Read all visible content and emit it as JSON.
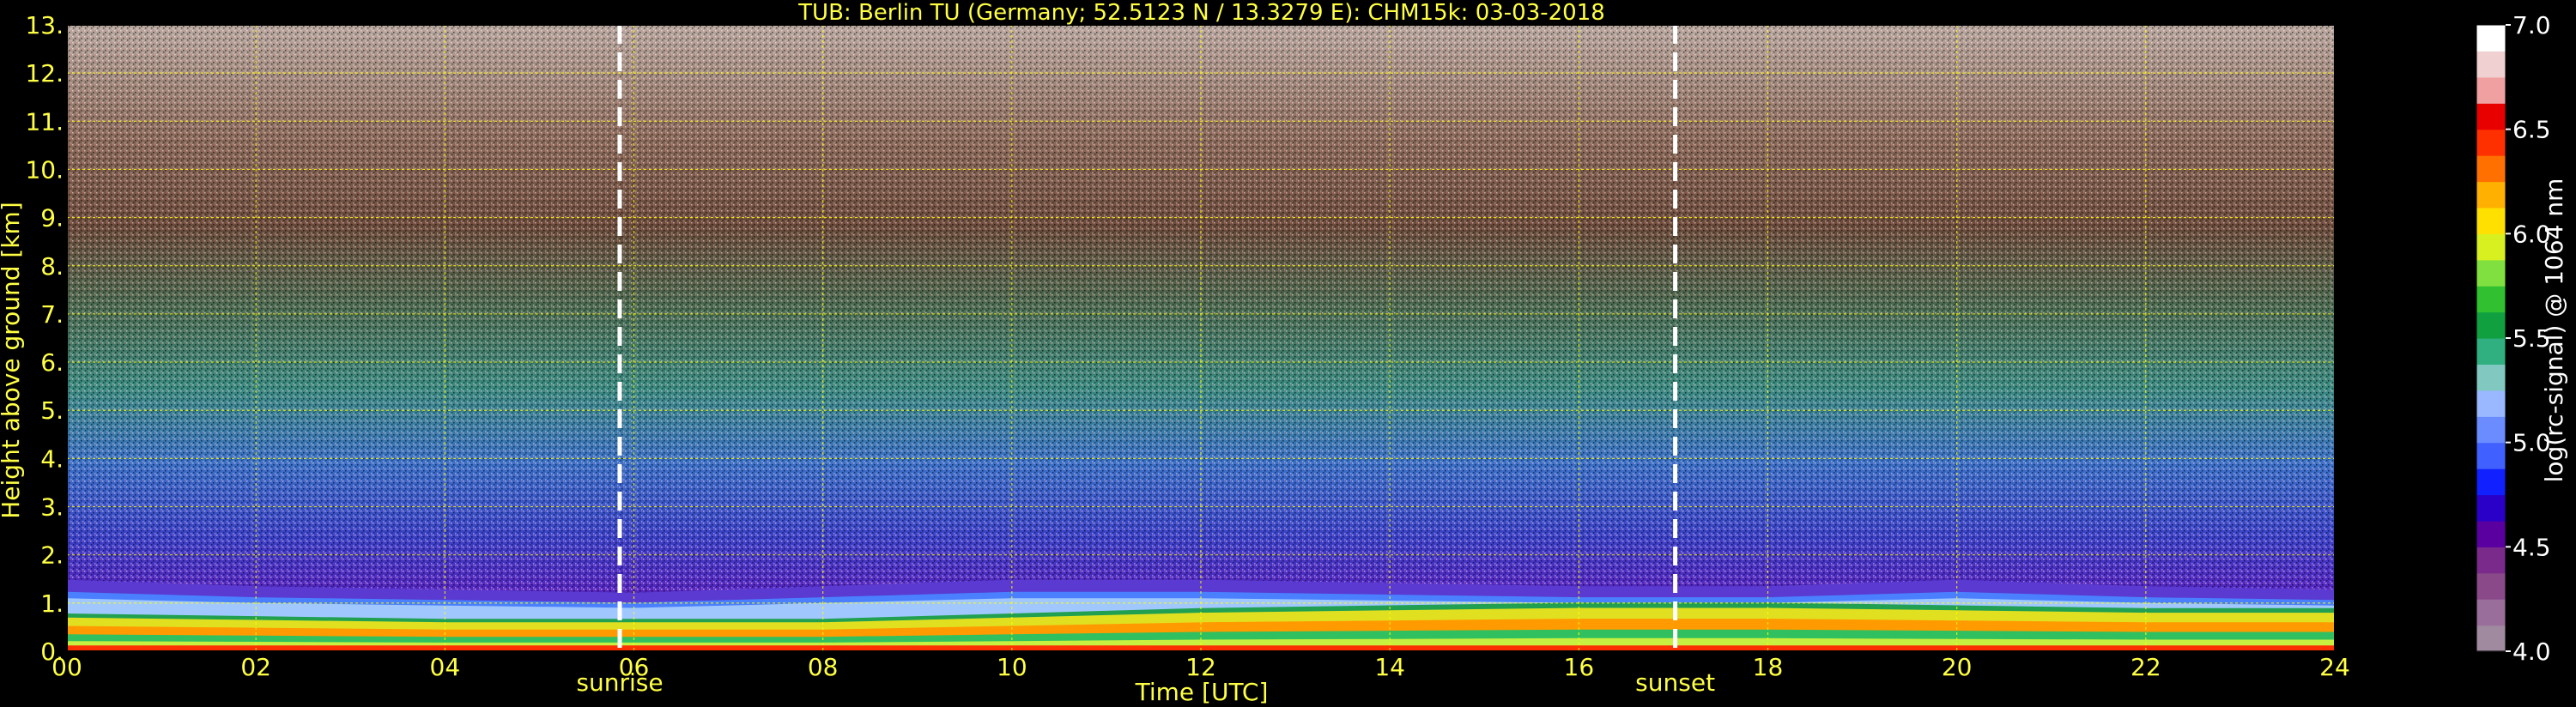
{
  "chart_data": {
    "type": "heatmap",
    "title": "TUB: Berlin TU (Germany; 52.5123 N / 13.3279 E):    CHM15k: 03-03-2018",
    "xlabel": "Time [UTC]",
    "ylabel": "Height above ground [km]",
    "xlim": [
      0,
      24
    ],
    "ylim": [
      0,
      13
    ],
    "x_ticks": [
      0,
      2,
      4,
      6,
      8,
      10,
      12,
      14,
      16,
      18,
      20,
      22,
      24
    ],
    "x_tick_labels": [
      "00",
      "02",
      "04",
      "06",
      "08",
      "10",
      "12",
      "14",
      "16",
      "18",
      "20",
      "22",
      "24"
    ],
    "y_ticks": [
      0,
      1,
      2,
      3,
      4,
      5,
      6,
      7,
      8,
      9,
      10,
      11,
      12,
      13
    ],
    "y_tick_labels": [
      "0.",
      "1.",
      "2.",
      "3.",
      "4.",
      "5.",
      "6.",
      "7.",
      "8.",
      "9.",
      "10.",
      "11.",
      "12.",
      "13."
    ],
    "grid": true,
    "grid_color": "#ffff00",
    "colorbar": {
      "label": "log(rc-signal) @ 1064 nm",
      "range": [
        4.0,
        7.0
      ],
      "ticks": [
        4.0,
        4.5,
        5.0,
        5.5,
        6.0,
        6.5,
        7.0
      ],
      "tick_labels": [
        "4.0",
        "4.5",
        "5.0",
        "5.5",
        "6.0",
        "6.5",
        "7.0"
      ],
      "colors": [
        "#a08aa0",
        "#9a6e9a",
        "#8a4a8a",
        "#7a2a8a",
        "#5a00a0",
        "#2a00c8",
        "#1020ff",
        "#4060ff",
        "#6a8cff",
        "#9ab8ff",
        "#80c8c0",
        "#30b080",
        "#10a040",
        "#30c030",
        "#80e040",
        "#d8f020",
        "#ffe000",
        "#ffb000",
        "#ff7000",
        "#ff3000",
        "#e80000",
        "#f0a0a0",
        "#f0d0d0",
        "#ffffff"
      ]
    },
    "markers": [
      {
        "name": "sunrise",
        "x": 5.85
      },
      {
        "name": "sunset",
        "x": 17.02
      }
    ],
    "layers": {
      "boundary_layer_top_km": [
        1.1,
        1.0,
        0.95,
        0.9,
        1.0,
        1.1,
        1.1,
        1.05,
        1.0,
        1.0,
        1.1,
        1.0,
        0.95
      ],
      "aerosol_top_km": [
        0.7,
        0.65,
        0.6,
        0.6,
        0.6,
        0.7,
        0.8,
        0.85,
        0.9,
        0.9,
        0.85,
        0.8,
        0.8
      ]
    }
  }
}
